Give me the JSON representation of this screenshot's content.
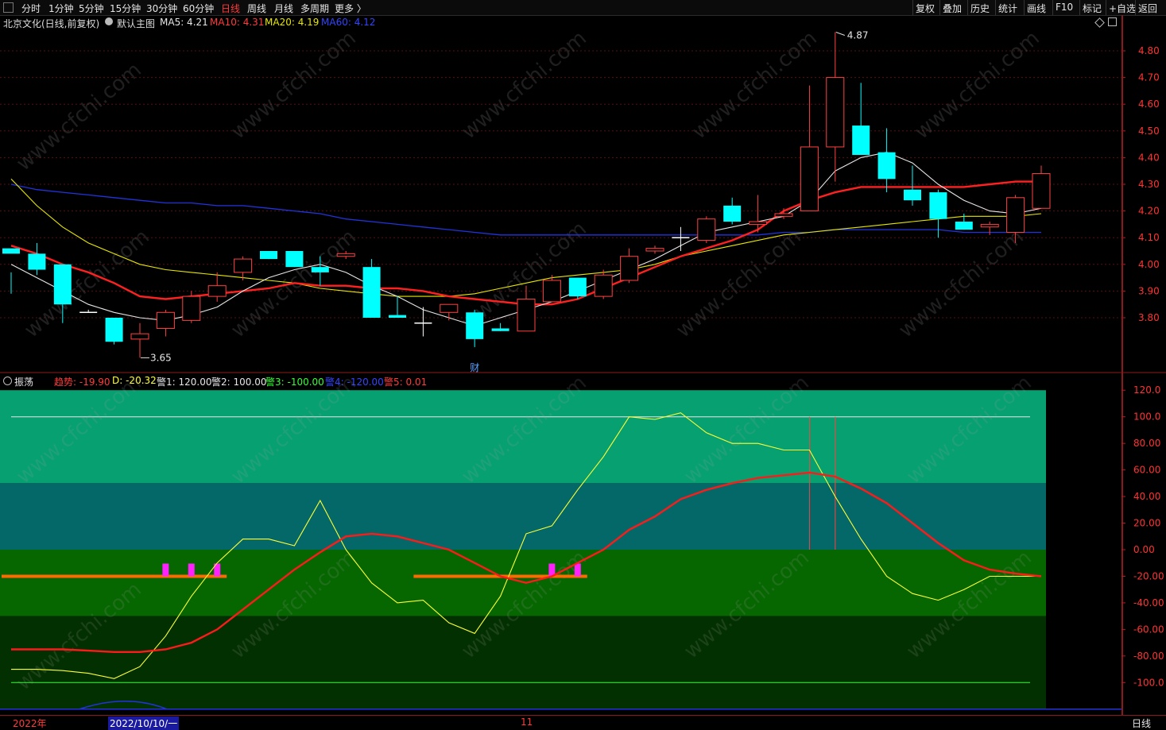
{
  "toolbar": {
    "left_items": [
      "分时",
      "1分钟",
      "5分钟",
      "15分钟",
      "30分钟",
      "60分钟",
      "日线",
      "周线",
      "月线",
      "多周期",
      "更多 〉"
    ],
    "active": "日线",
    "right_items": [
      "复权",
      "叠加",
      "历史",
      "统计",
      "画线",
      "F10",
      "标记",
      "+自选",
      "返回"
    ]
  },
  "main_chart": {
    "title": "北京文化(日线,前复权)",
    "indicator_name": "默认主图",
    "ma": [
      {
        "label": "MA5: 4.21",
        "color": "#e6e6e6"
      },
      {
        "label": "MA10: 4.31",
        "color": "#ff3b3b"
      },
      {
        "label": "MA20: 4.19",
        "color": "#e6e600"
      },
      {
        "label": "MA60: 4.12",
        "color": "#3344ff"
      }
    ],
    "high_label": "4.87",
    "low_label": "3.65",
    "cai_label": "财",
    "y_ticks": [
      "4.80",
      "4.70",
      "4.60",
      "4.50",
      "4.40",
      "4.30",
      "4.20",
      "4.10",
      "4.00",
      "3.90",
      "3.80"
    ]
  },
  "indicator": {
    "name": "振荡",
    "items": [
      {
        "label": "趋势: -19.90",
        "color": "#ff3b3b"
      },
      {
        "label": "D: -20.32",
        "color": "#ffff33"
      },
      {
        "label": "警1: 120.00",
        "color": "#e6e6e6"
      },
      {
        "label": "警2: 100.00",
        "color": "#e6e6e6"
      },
      {
        "label": "警3: -100.00",
        "color": "#33ff33"
      },
      {
        "label": "警4: -120.00",
        "color": "#3344ff"
      },
      {
        "label": "警5: 0.01",
        "color": "#ff3b3b"
      }
    ],
    "y_ticks": [
      "120.0",
      "100.0",
      "80.00",
      "60.00",
      "40.00",
      "20.00",
      "0.00",
      "-20.00",
      "-40.00",
      "-60.00",
      "-80.00",
      "-100.0"
    ]
  },
  "bottom": {
    "year": "2022年",
    "date": "2022/10/10/一",
    "month": "11",
    "period": "日线"
  },
  "watermark": "www.cfchi.com",
  "chart_data": {
    "type": "candlestick",
    "ohlc": [
      [
        4.06,
        3.97,
        3.89,
        4.04
      ],
      [
        4.04,
        4.08,
        3.96,
        3.98
      ],
      [
        4.0,
        4.0,
        3.78,
        3.85
      ],
      [
        3.82,
        3.83,
        3.82,
        3.82
      ],
      [
        3.8,
        3.78,
        3.7,
        3.71
      ],
      [
        3.72,
        3.78,
        3.65,
        3.74
      ],
      [
        3.76,
        3.83,
        3.73,
        3.82
      ],
      [
        3.79,
        3.9,
        3.78,
        3.88
      ],
      [
        3.88,
        3.97,
        3.86,
        3.92
      ],
      [
        3.97,
        4.03,
        3.94,
        4.02
      ],
      [
        4.05,
        4.05,
        4.02,
        4.02
      ],
      [
        4.05,
        4.05,
        3.99,
        3.99
      ],
      [
        3.99,
        4.03,
        3.92,
        3.97
      ],
      [
        4.03,
        4.05,
        4.02,
        4.04
      ],
      [
        3.99,
        4.02,
        3.81,
        3.8
      ],
      [
        3.81,
        3.88,
        3.8,
        3.8
      ],
      [
        3.78,
        3.84,
        3.73,
        3.78
      ],
      [
        3.82,
        3.85,
        3.79,
        3.85
      ],
      [
        3.82,
        3.83,
        3.69,
        3.72
      ],
      [
        3.76,
        3.78,
        3.75,
        3.75
      ],
      [
        3.75,
        3.92,
        3.75,
        3.87
      ],
      [
        3.86,
        3.96,
        3.86,
        3.94
      ],
      [
        3.95,
        3.95,
        3.87,
        3.88
      ],
      [
        3.88,
        3.98,
        3.87,
        3.96
      ],
      [
        3.94,
        4.06,
        3.93,
        4.03
      ],
      [
        4.05,
        4.07,
        4.04,
        4.06
      ],
      [
        4.1,
        4.14,
        4.05,
        4.1
      ],
      [
        4.09,
        4.18,
        4.08,
        4.17
      ],
      [
        4.22,
        4.25,
        4.15,
        4.16
      ],
      [
        4.15,
        4.26,
        4.12,
        4.16
      ],
      [
        4.18,
        4.21,
        4.17,
        4.19
      ],
      [
        4.2,
        4.67,
        4.2,
        4.44
      ],
      [
        4.44,
        4.87,
        4.31,
        4.7
      ],
      [
        4.52,
        4.68,
        4.41,
        4.41
      ],
      [
        4.42,
        4.51,
        4.27,
        4.32
      ],
      [
        4.28,
        4.37,
        4.22,
        4.24
      ],
      [
        4.27,
        4.28,
        4.1,
        4.17
      ],
      [
        4.16,
        4.19,
        4.13,
        4.13
      ],
      [
        4.14,
        4.16,
        4.11,
        4.15
      ],
      [
        4.12,
        4.26,
        4.08,
        4.25
      ],
      [
        4.21,
        4.37,
        4.21,
        4.34
      ]
    ],
    "ma5": [
      4.0,
      3.95,
      3.9,
      3.85,
      3.82,
      3.8,
      3.79,
      3.81,
      3.84,
      3.9,
      3.95,
      3.98,
      4.0,
      3.97,
      3.92,
      3.88,
      3.83,
      3.8,
      3.77,
      3.8,
      3.83,
      3.86,
      3.9,
      3.94,
      3.98,
      4.02,
      4.07,
      4.12,
      4.14,
      4.16,
      4.18,
      4.24,
      4.35,
      4.4,
      4.42,
      4.38,
      4.3,
      4.24,
      4.2,
      4.19,
      4.21
    ],
    "ma10": [
      4.07,
      4.04,
      4.0,
      3.97,
      3.93,
      3.88,
      3.87,
      3.88,
      3.89,
      3.9,
      3.91,
      3.93,
      3.92,
      3.92,
      3.91,
      3.91,
      3.9,
      3.88,
      3.87,
      3.86,
      3.85,
      3.85,
      3.87,
      3.91,
      3.95,
      3.99,
      4.03,
      4.06,
      4.09,
      4.13,
      4.2,
      4.24,
      4.27,
      4.29,
      4.29,
      4.29,
      4.29,
      4.29,
      4.3,
      4.31,
      4.31
    ],
    "ma20": [
      4.32,
      4.22,
      4.14,
      4.08,
      4.04,
      4.0,
      3.98,
      3.97,
      3.96,
      3.95,
      3.94,
      3.93,
      3.91,
      3.9,
      3.89,
      3.88,
      3.88,
      3.88,
      3.89,
      3.91,
      3.93,
      3.95,
      3.96,
      3.97,
      3.98,
      4.0,
      4.03,
      4.05,
      4.07,
      4.09,
      4.11,
      4.12,
      4.13,
      4.14,
      4.15,
      4.16,
      4.17,
      4.18,
      4.18,
      4.18,
      4.19
    ],
    "ma60": [
      4.3,
      4.28,
      4.27,
      4.26,
      4.25,
      4.24,
      4.23,
      4.23,
      4.22,
      4.22,
      4.21,
      4.2,
      4.19,
      4.17,
      4.16,
      4.15,
      4.14,
      4.13,
      4.12,
      4.11,
      4.11,
      4.11,
      4.11,
      4.11,
      4.11,
      4.11,
      4.11,
      4.11,
      4.11,
      4.11,
      4.12,
      4.12,
      4.13,
      4.13,
      4.13,
      4.13,
      4.13,
      4.12,
      4.12,
      4.12,
      4.12
    ],
    "trend": [
      -75,
      -75,
      -75,
      -76,
      -77,
      -77,
      -75,
      -70,
      -60,
      -45,
      -30,
      -15,
      -2,
      10,
      12,
      10,
      5,
      0,
      -10,
      -20,
      -25,
      -20,
      -10,
      0,
      15,
      25,
      38,
      45,
      50,
      54,
      56,
      58,
      55,
      46,
      35,
      20,
      5,
      -8,
      -15,
      -18,
      -20
    ],
    "d": [
      -90,
      -90,
      -91,
      -93,
      -97,
      -88,
      -65,
      -35,
      -10,
      8,
      8,
      3,
      37,
      0,
      -25,
      -40,
      -38,
      -55,
      -63,
      -35,
      12,
      18,
      45,
      70,
      100,
      98,
      103,
      88,
      80,
      80,
      75,
      75,
      40,
      8,
      -20,
      -33,
      -38,
      -30,
      -20,
      -20,
      -20
    ],
    "signal_on": [
      true,
      true,
      true,
      true,
      true,
      true,
      true,
      true,
      true,
      false,
      false,
      false,
      false,
      false,
      false,
      false,
      true,
      true,
      true,
      true,
      true,
      true,
      true,
      false,
      false,
      false,
      false,
      false,
      false,
      false,
      false,
      false,
      false,
      false,
      false,
      false,
      false,
      false,
      false,
      false,
      false
    ],
    "markers": [
      6,
      7,
      8,
      21,
      22
    ],
    "price_range": [
      3.6,
      4.9
    ],
    "osc_range": [
      -125,
      125
    ]
  }
}
